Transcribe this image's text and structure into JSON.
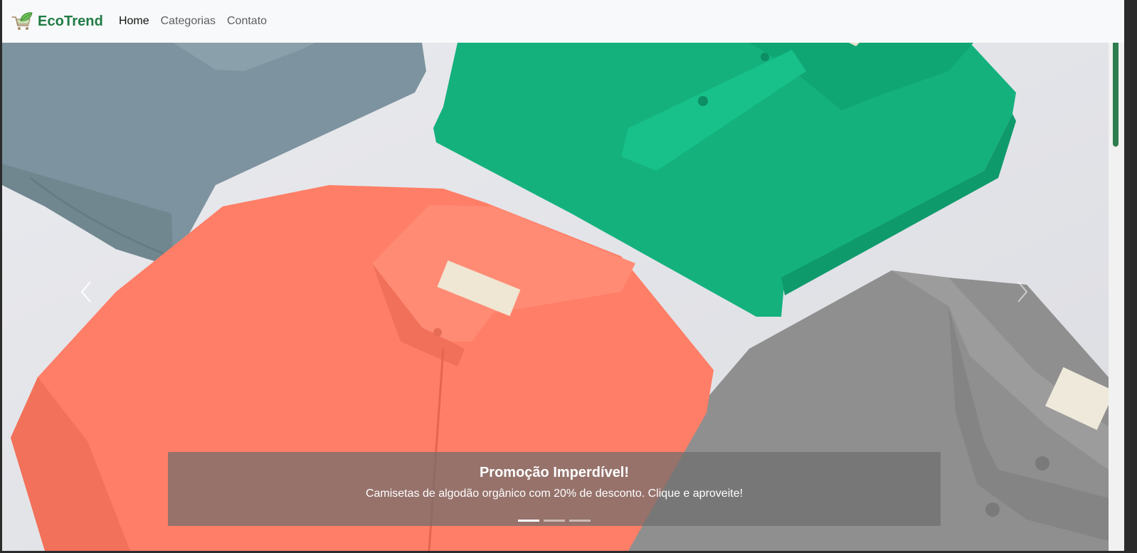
{
  "navbar": {
    "brand": "EcoTrend",
    "logo_icon": "eco-cart-icon",
    "links": [
      {
        "label": "Home",
        "active": true
      },
      {
        "label": "Categorias",
        "active": false
      },
      {
        "label": "Contato",
        "active": false
      }
    ]
  },
  "carousel": {
    "slides_total": 3,
    "active_slide": 1,
    "caption": {
      "title": "Promoção Imperdível!",
      "text": "Camisetas de algodão orgânico com 20% de desconto. Clique e aproveite!"
    },
    "controls": {
      "prev_icon": "chevron-left-icon",
      "next_icon": "chevron-right-icon"
    },
    "image_subject": "folded-polo-shirts"
  },
  "colors": {
    "brand": "#1e7b44",
    "navbar_bg": "#f8f9fa",
    "shirt_blue": "#7c929f",
    "shirt_green": "#12b07d",
    "shirt_coral": "#ff7f67",
    "shirt_gray": "#8e8e8e",
    "scroll_thumb": "#2e7d4f"
  }
}
